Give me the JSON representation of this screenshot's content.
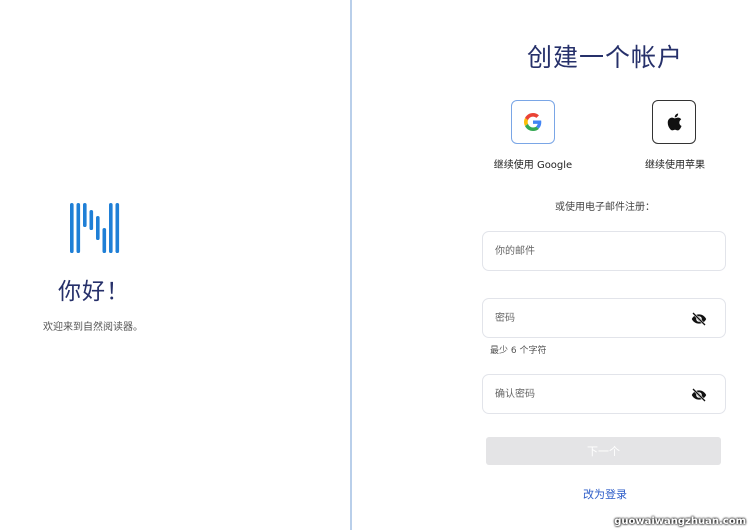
{
  "left": {
    "greeting": "你好！",
    "welcome": "欢迎来到自然阅读器。"
  },
  "signup": {
    "title": "创建一个帐户",
    "google_label": "继续使用 Google",
    "apple_label": "继续使用苹果",
    "or_email": "或使用电子邮件注册：",
    "email_placeholder": "你的邮件",
    "password_placeholder": "密码",
    "password_hint": "最少 6 个字符",
    "confirm_placeholder": "确认密码",
    "next_label": "下一个",
    "login_link": "改为登录"
  },
  "watermark": "guowaiwangzhuan.com",
  "colors": {
    "title": "#26306a",
    "logo": "#1f7fd6",
    "link": "#2c5cc8",
    "divider": "#b9cfea"
  },
  "icons": [
    "naturalreader-logo-icon",
    "google-icon",
    "apple-icon",
    "eye-slash-icon"
  ]
}
